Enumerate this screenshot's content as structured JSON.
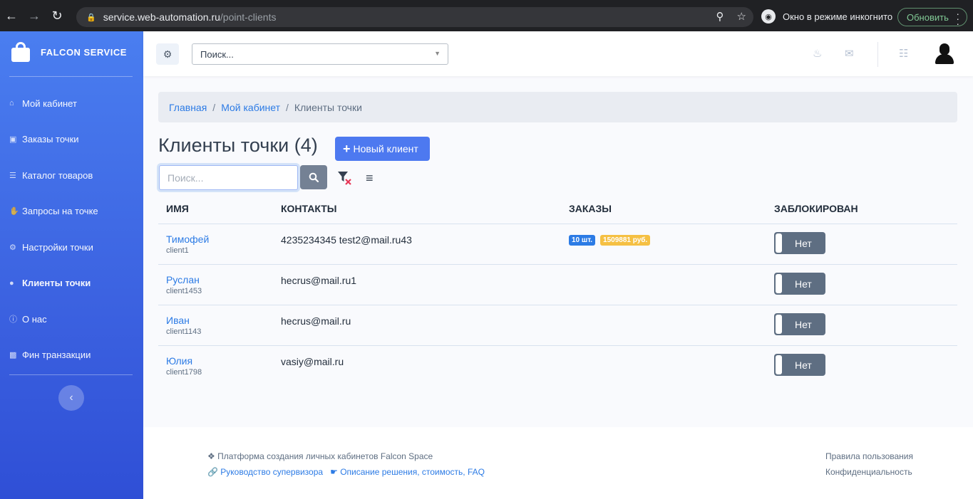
{
  "browser": {
    "url_host": "service.web-automation.ru",
    "url_path": "/point-clients",
    "incognito_label": "Окно в режиме инкогнито",
    "update_label": "Обновить"
  },
  "sidebar": {
    "brand": "FALCON SERVICE",
    "items": [
      {
        "label": "Мой кабинет",
        "icon": "home-icon"
      },
      {
        "label": "Заказы точки",
        "icon": "bag-icon"
      },
      {
        "label": "Каталог товаров",
        "icon": "list-icon"
      },
      {
        "label": "Запросы на точке",
        "icon": "hand-icon"
      },
      {
        "label": "Настройки точки",
        "icon": "gears-icon"
      },
      {
        "label": "Клиенты точки",
        "icon": "users-icon",
        "active": true
      },
      {
        "label": "О нас",
        "icon": "info-icon"
      },
      {
        "label": "Фин транзакции",
        "icon": "money-icon"
      }
    ]
  },
  "topbar": {
    "search_placeholder": "Поиск..."
  },
  "breadcrumb": {
    "home": "Главная",
    "cabinet": "Мой кабинет",
    "current": "Клиенты точки"
  },
  "page": {
    "title": "Клиенты точки",
    "count": "(4)",
    "new_button": "Новый клиент",
    "search_placeholder": "Поиск..."
  },
  "table": {
    "headers": {
      "name": "ИМЯ",
      "contacts": "КОНТАКТЫ",
      "orders": "ЗАКАЗЫ",
      "blocked": "ЗАБЛОКИРОВАН"
    },
    "rows": [
      {
        "name": "Тимофей",
        "login": "client1",
        "contacts": "4235234345 test2@mail.ru43",
        "orders_count": "10 шт.",
        "orders_sum": "1509881 руб.",
        "blocked": "Нет"
      },
      {
        "name": "Руслан",
        "login": "client1453",
        "contacts": "hecrus@mail.ru1",
        "orders_count": "",
        "orders_sum": "",
        "blocked": "Нет"
      },
      {
        "name": "Иван",
        "login": "client1143",
        "contacts": "hecrus@mail.ru",
        "orders_count": "",
        "orders_sum": "",
        "blocked": "Нет"
      },
      {
        "name": "Юлия",
        "login": "client1798",
        "contacts": "vasiy@mail.ru",
        "orders_count": "",
        "orders_sum": "",
        "blocked": "Нет"
      }
    ]
  },
  "footer": {
    "platform": "Платформа создания личных кабинетов Falcon Space",
    "guide": "Руководство супервизора",
    "description": "Описание решения, стоимость, FAQ",
    "terms": "Правила пользования",
    "privacy": "Конфиденциальность"
  },
  "colors": {
    "sidebar_top": "#4a7ef0",
    "sidebar_bottom": "#2f4fd6",
    "primary": "#4d79f0",
    "link": "#2c7be5",
    "badge_yellow": "#f5c043",
    "toggle_bg": "#5e6e82"
  }
}
